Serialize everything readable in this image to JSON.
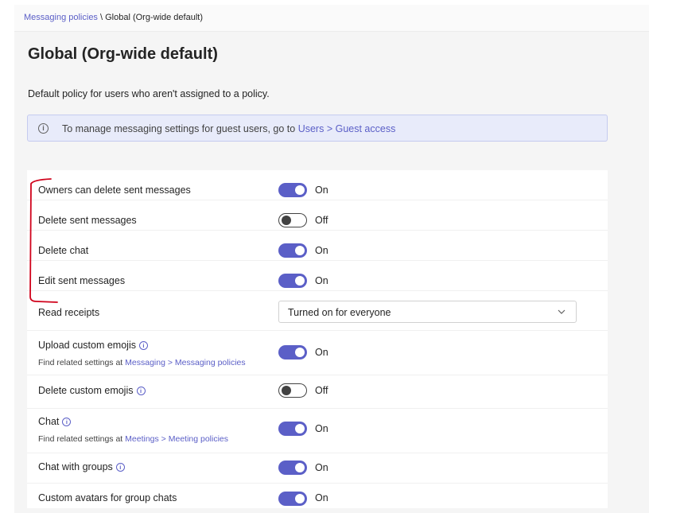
{
  "breadcrumb": {
    "parent": "Messaging policies",
    "separator": " \\ ",
    "current": "Global (Org-wide default)"
  },
  "page": {
    "title": "Global (Org-wide default)",
    "description": "Default policy for users who aren't assigned to a policy."
  },
  "banner": {
    "icon": "info-icon",
    "text_prefix": "To manage messaging settings for guest users, go to ",
    "link": "Users > Guest access"
  },
  "colors": {
    "accent": "#5b5fc7",
    "annotation": "#d0021b"
  },
  "settings": [
    {
      "label": "Owners can delete sent messages",
      "type": "toggle",
      "on": true,
      "state": "On"
    },
    {
      "label": "Delete sent messages",
      "type": "toggle",
      "on": false,
      "state": "Off"
    },
    {
      "label": "Delete chat",
      "type": "toggle",
      "on": true,
      "state": "On"
    },
    {
      "label": "Edit sent messages",
      "type": "toggle",
      "on": true,
      "state": "On"
    },
    {
      "label": "Read receipts",
      "type": "dropdown",
      "value": "Turned on for everyone"
    },
    {
      "label": "Upload custom emojis",
      "type": "toggle",
      "on": true,
      "state": "On",
      "info": "ⓘ",
      "sub_prefix": "Find related settings at ",
      "sub_link": "Messaging > Messaging policies"
    },
    {
      "label": "Delete custom emojis",
      "type": "toggle",
      "on": false,
      "state": "Off",
      "info": "ⓘ"
    },
    {
      "label": "Chat",
      "type": "toggle",
      "on": true,
      "state": "On",
      "info": "ⓘ",
      "sub_prefix": "Find related settings at ",
      "sub_link": "Meetings > Meeting policies"
    },
    {
      "label": "Chat with groups",
      "type": "toggle",
      "on": true,
      "state": "On",
      "info": "ⓘ"
    },
    {
      "label": "Custom avatars for group chats",
      "type": "toggle",
      "on": true,
      "state": "On"
    }
  ]
}
